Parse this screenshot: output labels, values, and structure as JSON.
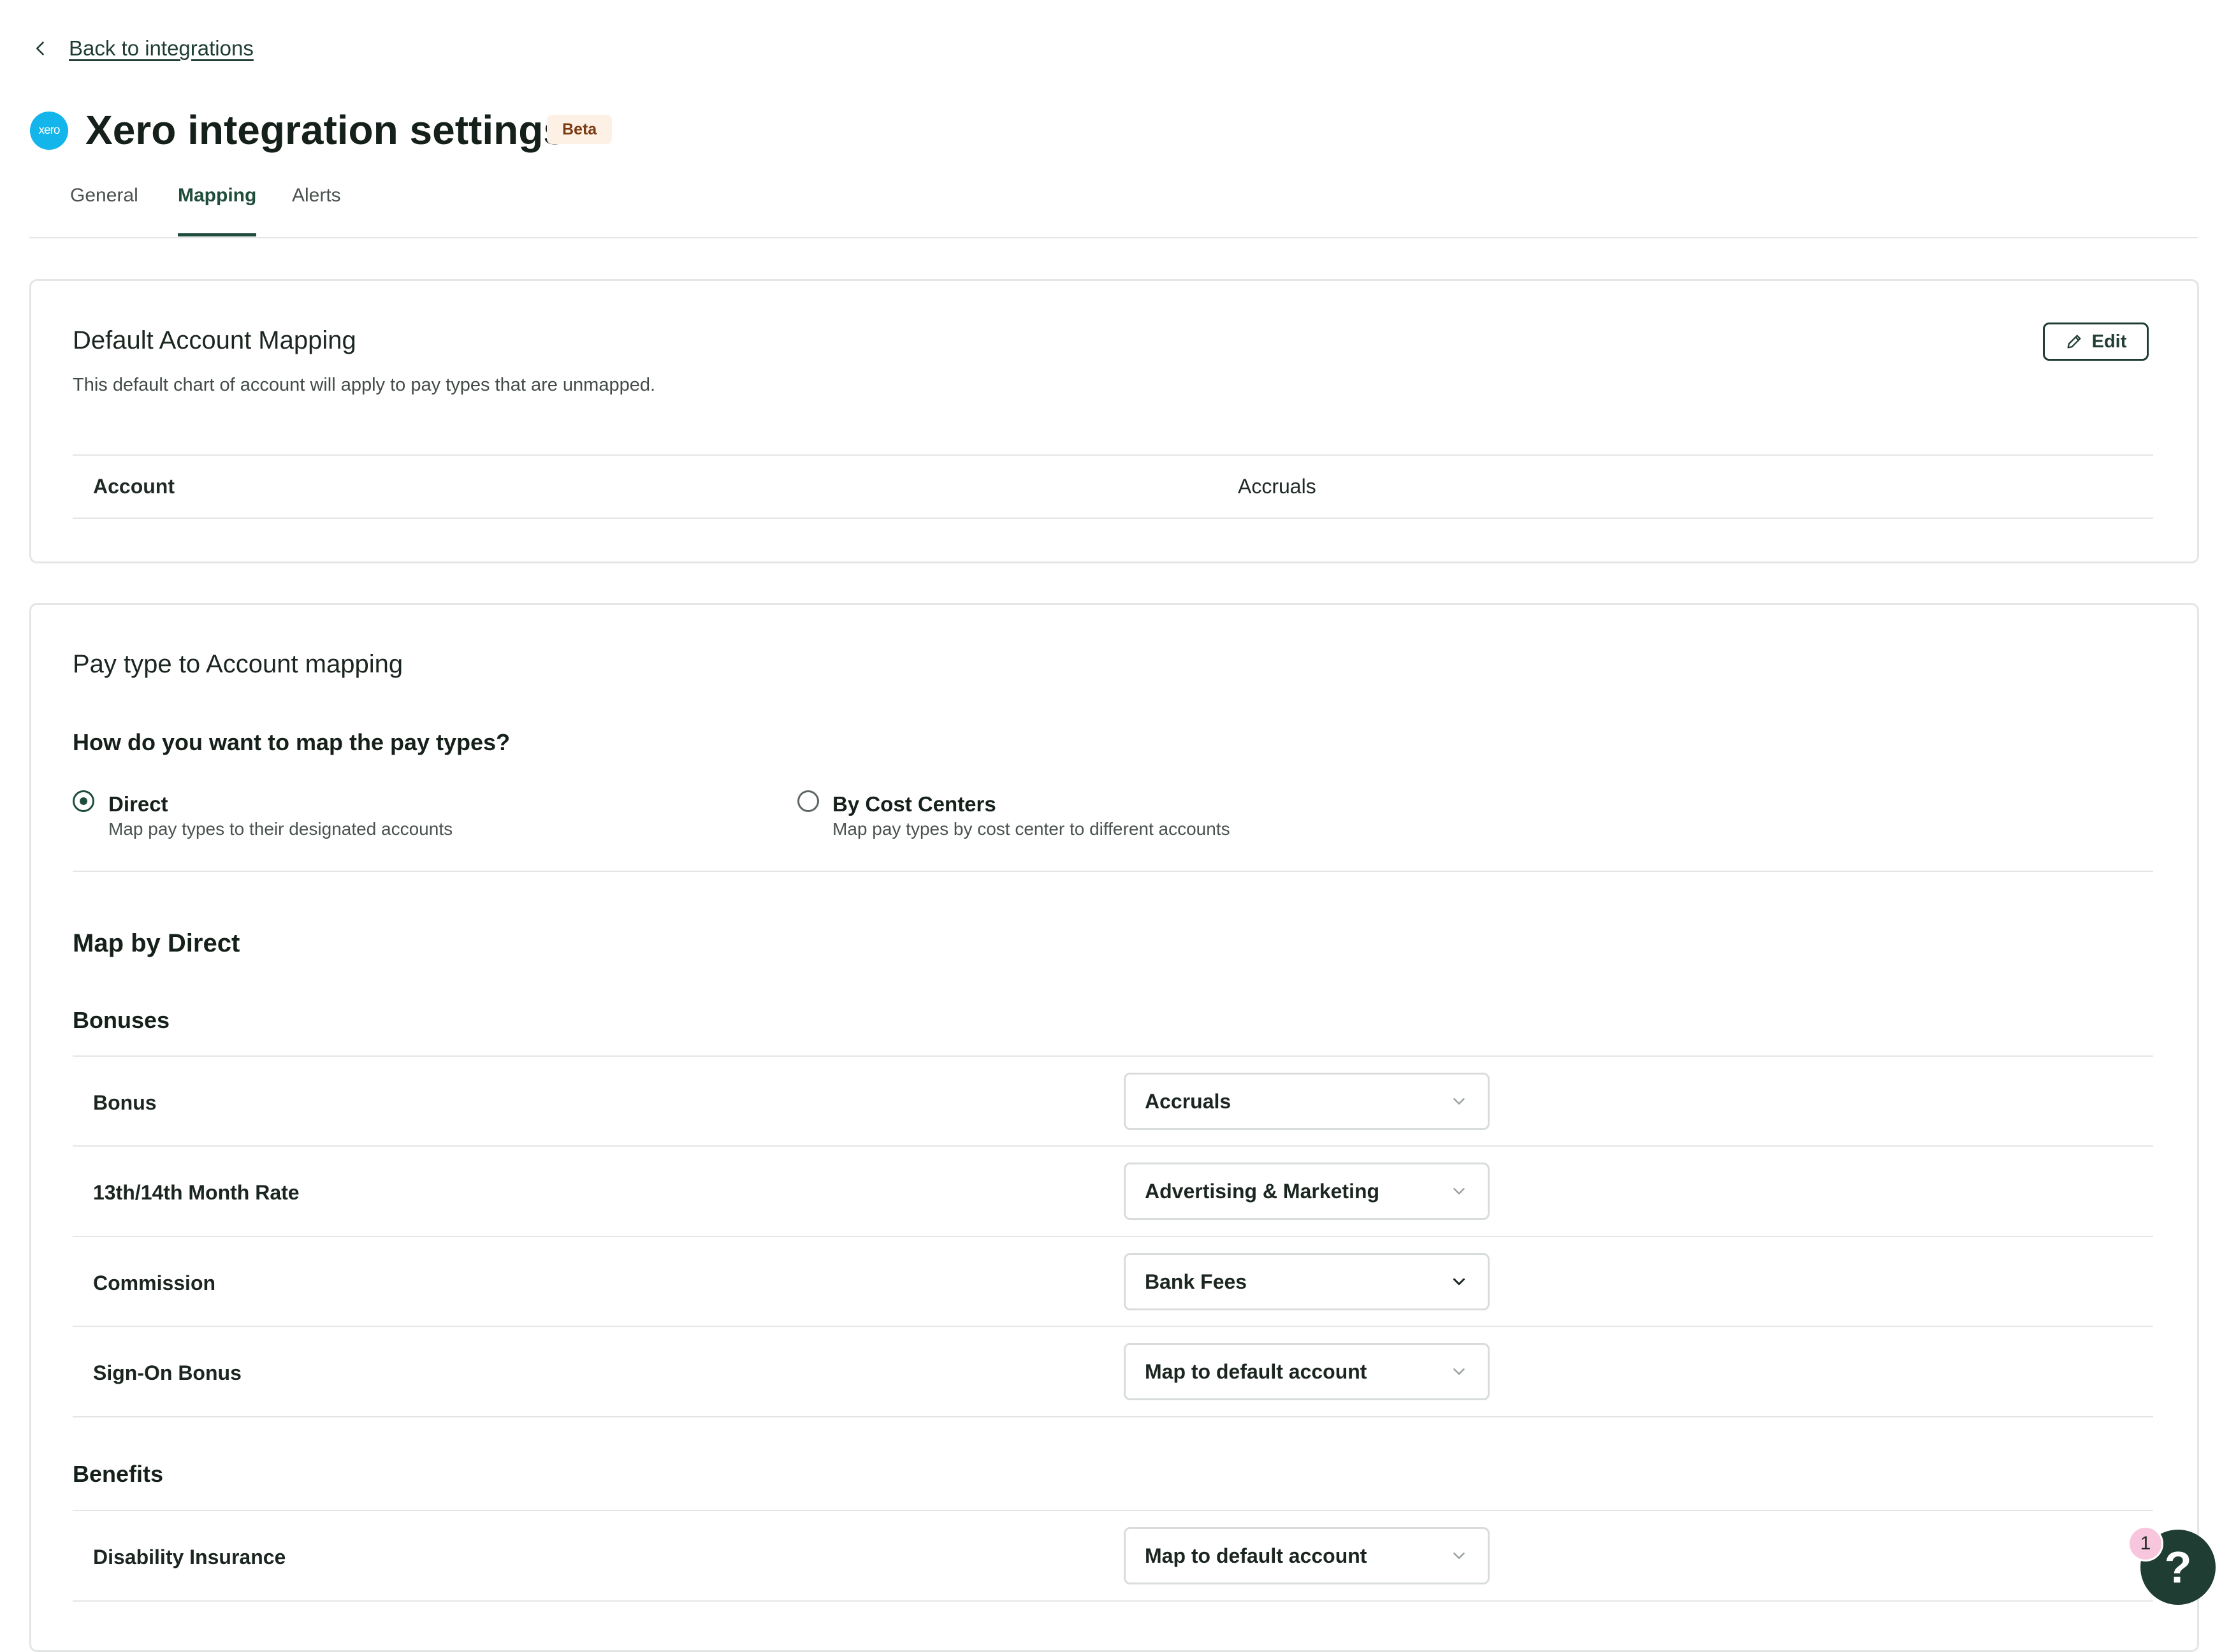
{
  "nav": {
    "back_label": "Back to integrations",
    "back_icon": "chevron-left-icon"
  },
  "header": {
    "logo_text": "xero",
    "title": "Xero integration settings",
    "badge": "Beta"
  },
  "tabs": [
    {
      "label": "General",
      "active": false
    },
    {
      "label": "Mapping",
      "active": true
    },
    {
      "label": "Alerts",
      "active": false
    }
  ],
  "default_mapping": {
    "title": "Default Account Mapping",
    "description": "This default chart of account will apply to pay types that are unmapped.",
    "edit_label": "Edit",
    "edit_icon": "pencil-icon",
    "table": {
      "col_account": "Account",
      "col_value": "Accruals"
    }
  },
  "paytype_mapping": {
    "title": "Pay type to Account mapping",
    "question": "How do you want to map the pay types?",
    "options": [
      {
        "label": "Direct",
        "sub": "Map pay types to their designated accounts",
        "checked": true
      },
      {
        "label": "By Cost Centers",
        "sub": "Map pay types by cost center to different accounts",
        "checked": false
      }
    ],
    "section_title": "Map by Direct",
    "groups": [
      {
        "title": "Bonuses",
        "rows": [
          {
            "label": "Bonus",
            "value": "Accruals"
          },
          {
            "label": "13th/14th Month Rate",
            "value": "Advertising & Marketing"
          },
          {
            "label": "Commission",
            "value": "Bank Fees"
          },
          {
            "label": "Sign-On Bonus",
            "value": "Map to default account"
          }
        ]
      },
      {
        "title": "Benefits",
        "rows": [
          {
            "label": "Disability Insurance",
            "value": "Map to default account"
          }
        ]
      }
    ]
  },
  "help": {
    "label": "?",
    "badge_count": "1"
  },
  "colors": {
    "brand": "#1f3d33",
    "xero": "#13b5ea",
    "badge_bg": "#fdf0e4",
    "border": "#e3e6e4"
  }
}
